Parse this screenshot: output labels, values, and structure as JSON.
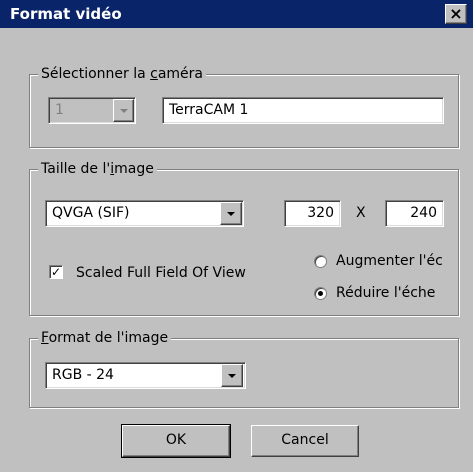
{
  "window": {
    "title": "Format vidéo",
    "close_glyph": "×"
  },
  "camera_group": {
    "label_pre": "Sélectionner la ",
    "label_acc": "c",
    "label_post": "améra",
    "index_value": "1",
    "camera_name": "TerraCAM 1"
  },
  "size_group": {
    "label_pre": "Taille de l'",
    "label_acc": "i",
    "label_post": "mage",
    "resolution": "QVGA (SIF)",
    "width": "320",
    "times": "X",
    "height": "240",
    "checkbox_label": "Scaled Full Field Of View",
    "checkbox_mark": "✓",
    "radio_increase": "Augmenter l'éc",
    "radio_reduce": "Réduire l'éche"
  },
  "format_group": {
    "label_acc": "F",
    "label_post": "ormat de l'image",
    "format": "RGB  - 24"
  },
  "buttons": {
    "ok": "OK",
    "cancel": "Cancel"
  }
}
